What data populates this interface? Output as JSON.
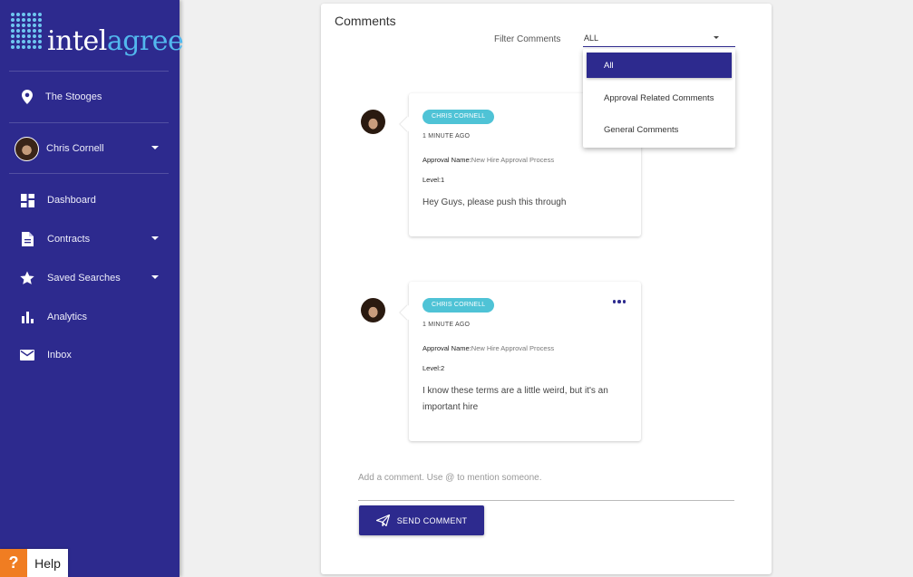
{
  "brand": {
    "name_part1": "intel",
    "name_part2": "agree"
  },
  "sidebar": {
    "location": "The Stooges",
    "user": "Chris Cornell",
    "items": [
      {
        "label": "Dashboard",
        "icon": "dashboard-icon",
        "has_caret": false
      },
      {
        "label": "Contracts",
        "icon": "document-icon",
        "has_caret": true
      },
      {
        "label": "Saved Searches",
        "icon": "star-icon",
        "has_caret": true
      },
      {
        "label": "Analytics",
        "icon": "bar-chart-icon",
        "has_caret": false
      },
      {
        "label": "Inbox",
        "icon": "mail-icon",
        "has_caret": false
      }
    ],
    "accent": "#2d2a8e"
  },
  "help": {
    "symbol": "?",
    "label": "Help"
  },
  "comments_panel": {
    "title": "Comments",
    "filter_label": "Filter Comments",
    "filter_value": "ALL",
    "filter_options": [
      "All",
      "Approval Related Comments",
      "General Comments"
    ],
    "selected_option": "All",
    "comments": [
      {
        "author": "CHRIS CORNELL",
        "time": "1 MINUTE AGO",
        "approval_label": "Approval Name:",
        "approval_value": "New Hire Approval Process",
        "level_label": "Level:",
        "level_value": "1",
        "text": "Hey Guys, please push this through"
      },
      {
        "author": "CHRIS CORNELL",
        "time": "1 MINUTE AGO",
        "approval_label": "Approval Name:",
        "approval_value": "New Hire Approval Process",
        "level_label": "Level:",
        "level_value": "2",
        "text": "I know these terms are a little weird, but it's an important hire"
      }
    ],
    "input_placeholder": "Add a comment. Use @ to mention someone.",
    "send_label": "SEND COMMENT"
  },
  "colors": {
    "primary": "#2d2a8e",
    "badge": "#4fc3d6",
    "logo_accent": "#52b8ee",
    "help": "#f07d22"
  }
}
